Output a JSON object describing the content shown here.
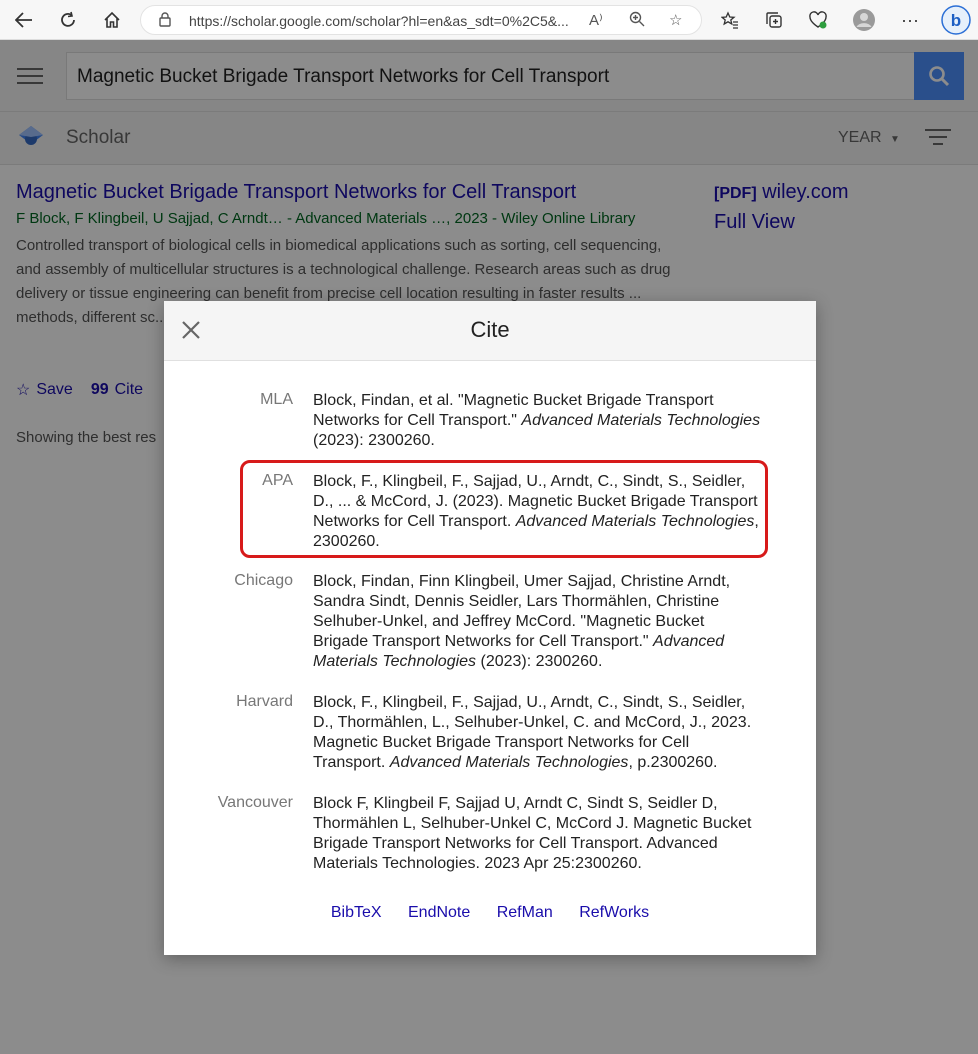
{
  "browser": {
    "url": "https://scholar.google.com/scholar?hl=en&as_sdt=0%2C5&..."
  },
  "search": {
    "query": "Magnetic Bucket Brigade Transport Networks for Cell Transport"
  },
  "scholar_header": {
    "title": "Scholar",
    "year_filter": "YEAR"
  },
  "result": {
    "title": "Magnetic Bucket Brigade Transport Networks for Cell Transport",
    "authors_line": "F Block, F Klingbeil, U Sajjad, C Arndt… - Advanced Materials …, 2023 - Wiley Online Library",
    "snippet": "Controlled transport of biological cells in biomedical applications such as sorting, cell sequencing, and assembly of multicellular structures is a technological challenge. Research areas such as drug delivery or tissue engineering can benefit from precise cell location resulting in faster results ... methods, different sc... transport network, en...",
    "save_label": "Save",
    "cite_label": "Cite",
    "pdf_tag": "[PDF]",
    "pdf_domain": "wiley.com",
    "full_view": "Full View",
    "showing": "Showing the best res"
  },
  "dialog": {
    "title": "Cite",
    "citations": [
      {
        "style": "MLA",
        "pre": "Block, Findan, et al. \"Magnetic Bucket Brigade Transport Networks for Cell Transport.\" ",
        "italic": "Advanced Materials Technologies",
        "post": " (2023): 2300260."
      },
      {
        "style": "APA",
        "pre": "Block, F., Klingbeil, F., Sajjad, U., Arndt, C., Sindt, S., Seidler, D., ... & McCord, J. (2023). Magnetic Bucket Brigade Transport Networks for Cell Transport. ",
        "italic": "Advanced Materials Technologies",
        "post": ", 2300260."
      },
      {
        "style": "Chicago",
        "pre": "Block, Findan, Finn Klingbeil, Umer Sajjad, Christine Arndt, Sandra Sindt, Dennis Seidler, Lars Thormählen, Christine Selhuber-Unkel, and Jeffrey McCord. \"Magnetic Bucket Brigade Transport Networks for Cell Transport.\" ",
        "italic": "Advanced Materials Technologies",
        "post": " (2023): 2300260."
      },
      {
        "style": "Harvard",
        "pre": "Block, F., Klingbeil, F., Sajjad, U., Arndt, C., Sindt, S., Seidler, D., Thormählen, L., Selhuber-Unkel, C. and McCord, J., 2023. Magnetic Bucket Brigade Transport Networks for Cell Transport. ",
        "italic": "Advanced Materials Technologies",
        "post": ", p.2300260."
      },
      {
        "style": "Vancouver",
        "pre": "Block F, Klingbeil F, Sajjad U, Arndt C, Sindt S, Seidler D, Thormählen L, Selhuber-Unkel C, McCord J. Magnetic Bucket Brigade Transport Networks for Cell Transport. Advanced Materials Technologies. 2023 Apr 25:2300260.",
        "italic": "",
        "post": ""
      }
    ],
    "exports": [
      "BibTeX",
      "EndNote",
      "RefMan",
      "RefWorks"
    ]
  },
  "colors": {
    "link": "#1a0dab",
    "author_green": "#006621",
    "search_button": "#4d90fe",
    "highlight": "#d71a1a"
  }
}
